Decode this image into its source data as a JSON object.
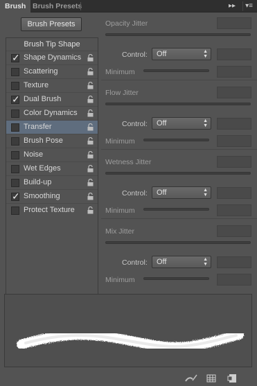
{
  "tabs": {
    "brush": "Brush",
    "brush_presets": "Brush Presets"
  },
  "toolbar": {
    "presets_button": "Brush Presets"
  },
  "list": {
    "header": "Brush Tip Shape",
    "items": [
      {
        "label": "Shape Dynamics",
        "checked": true,
        "selected": false
      },
      {
        "label": "Scattering",
        "checked": false,
        "selected": false
      },
      {
        "label": "Texture",
        "checked": false,
        "selected": false
      },
      {
        "label": "Dual Brush",
        "checked": true,
        "selected": false
      },
      {
        "label": "Color Dynamics",
        "checked": false,
        "selected": false
      },
      {
        "label": "Transfer",
        "checked": false,
        "selected": true
      },
      {
        "label": "Brush Pose",
        "checked": false,
        "selected": false
      },
      {
        "label": "Noise",
        "checked": false,
        "selected": false
      },
      {
        "label": "Wet Edges",
        "checked": false,
        "selected": false
      },
      {
        "label": "Build-up",
        "checked": false,
        "selected": false
      },
      {
        "label": "Smoothing",
        "checked": true,
        "selected": false
      },
      {
        "label": "Protect Texture",
        "checked": false,
        "selected": false
      }
    ]
  },
  "settings": {
    "opacity": {
      "title": "Opacity Jitter",
      "control_label": "Control:",
      "control_value": "Off",
      "minimum_label": "Minimum"
    },
    "flow": {
      "title": "Flow Jitter",
      "control_label": "Control:",
      "control_value": "Off",
      "minimum_label": "Minimum"
    },
    "wetness": {
      "title": "Wetness Jitter",
      "control_label": "Control:",
      "control_value": "Off",
      "minimum_label": "Minimum"
    },
    "mix": {
      "title": "Mix Jitter",
      "control_label": "Control:",
      "control_value": "Off",
      "minimum_label": "Minimum"
    }
  },
  "icons": {
    "expand": "double-chevron-right-icon",
    "menu": "panel-menu-icon",
    "lock": "lock-icon",
    "check": "checkmark-icon",
    "dropdown": "updown-arrow-icon",
    "toggle_preview": "brush-toggle-icon",
    "grid": "grid-icon",
    "new_preset": "new-preset-icon"
  },
  "colors": {
    "panel_bg": "#535353",
    "selected_row": "#5f6d7e",
    "stroke": "#ffffff"
  }
}
